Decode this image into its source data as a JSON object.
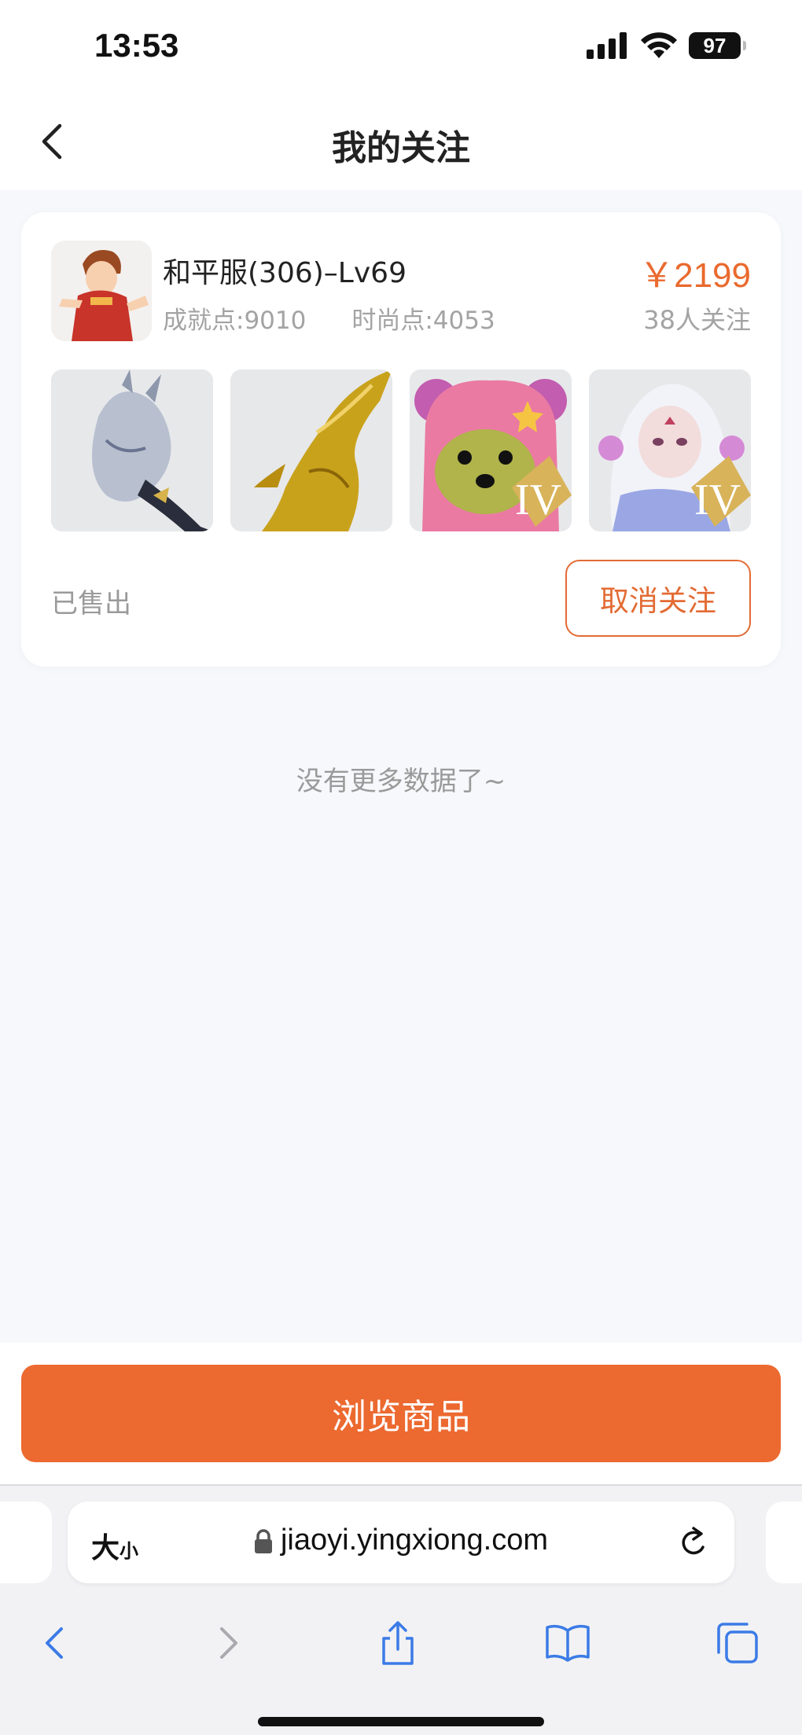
{
  "status_bar": {
    "time": "13:53",
    "battery": "97"
  },
  "header": {
    "title": "我的关注"
  },
  "card": {
    "title": "和平服(306)–Lv69",
    "achievement": "成就点:9010",
    "fashion": "时尚点:4053",
    "price": "￥2199",
    "followers": "38人关注",
    "thumbnails": [
      {
        "name": "silver-dragon",
        "badge": ""
      },
      {
        "name": "golden-phoenix",
        "badge": ""
      },
      {
        "name": "pink-bear",
        "badge": "IV"
      },
      {
        "name": "white-spirit",
        "badge": "IV"
      }
    ],
    "status": "已售出",
    "unfollow_label": "取消关注"
  },
  "no_more_text": "没有更多数据了~",
  "browse_label": "浏览商品",
  "safari": {
    "aa_big": "大",
    "aa_small": "小",
    "url": "jiaoyi.yingxiong.com"
  },
  "colors": {
    "accent": "#ec6930",
    "price": "#ea6a2e",
    "muted": "#a3a3a3"
  }
}
